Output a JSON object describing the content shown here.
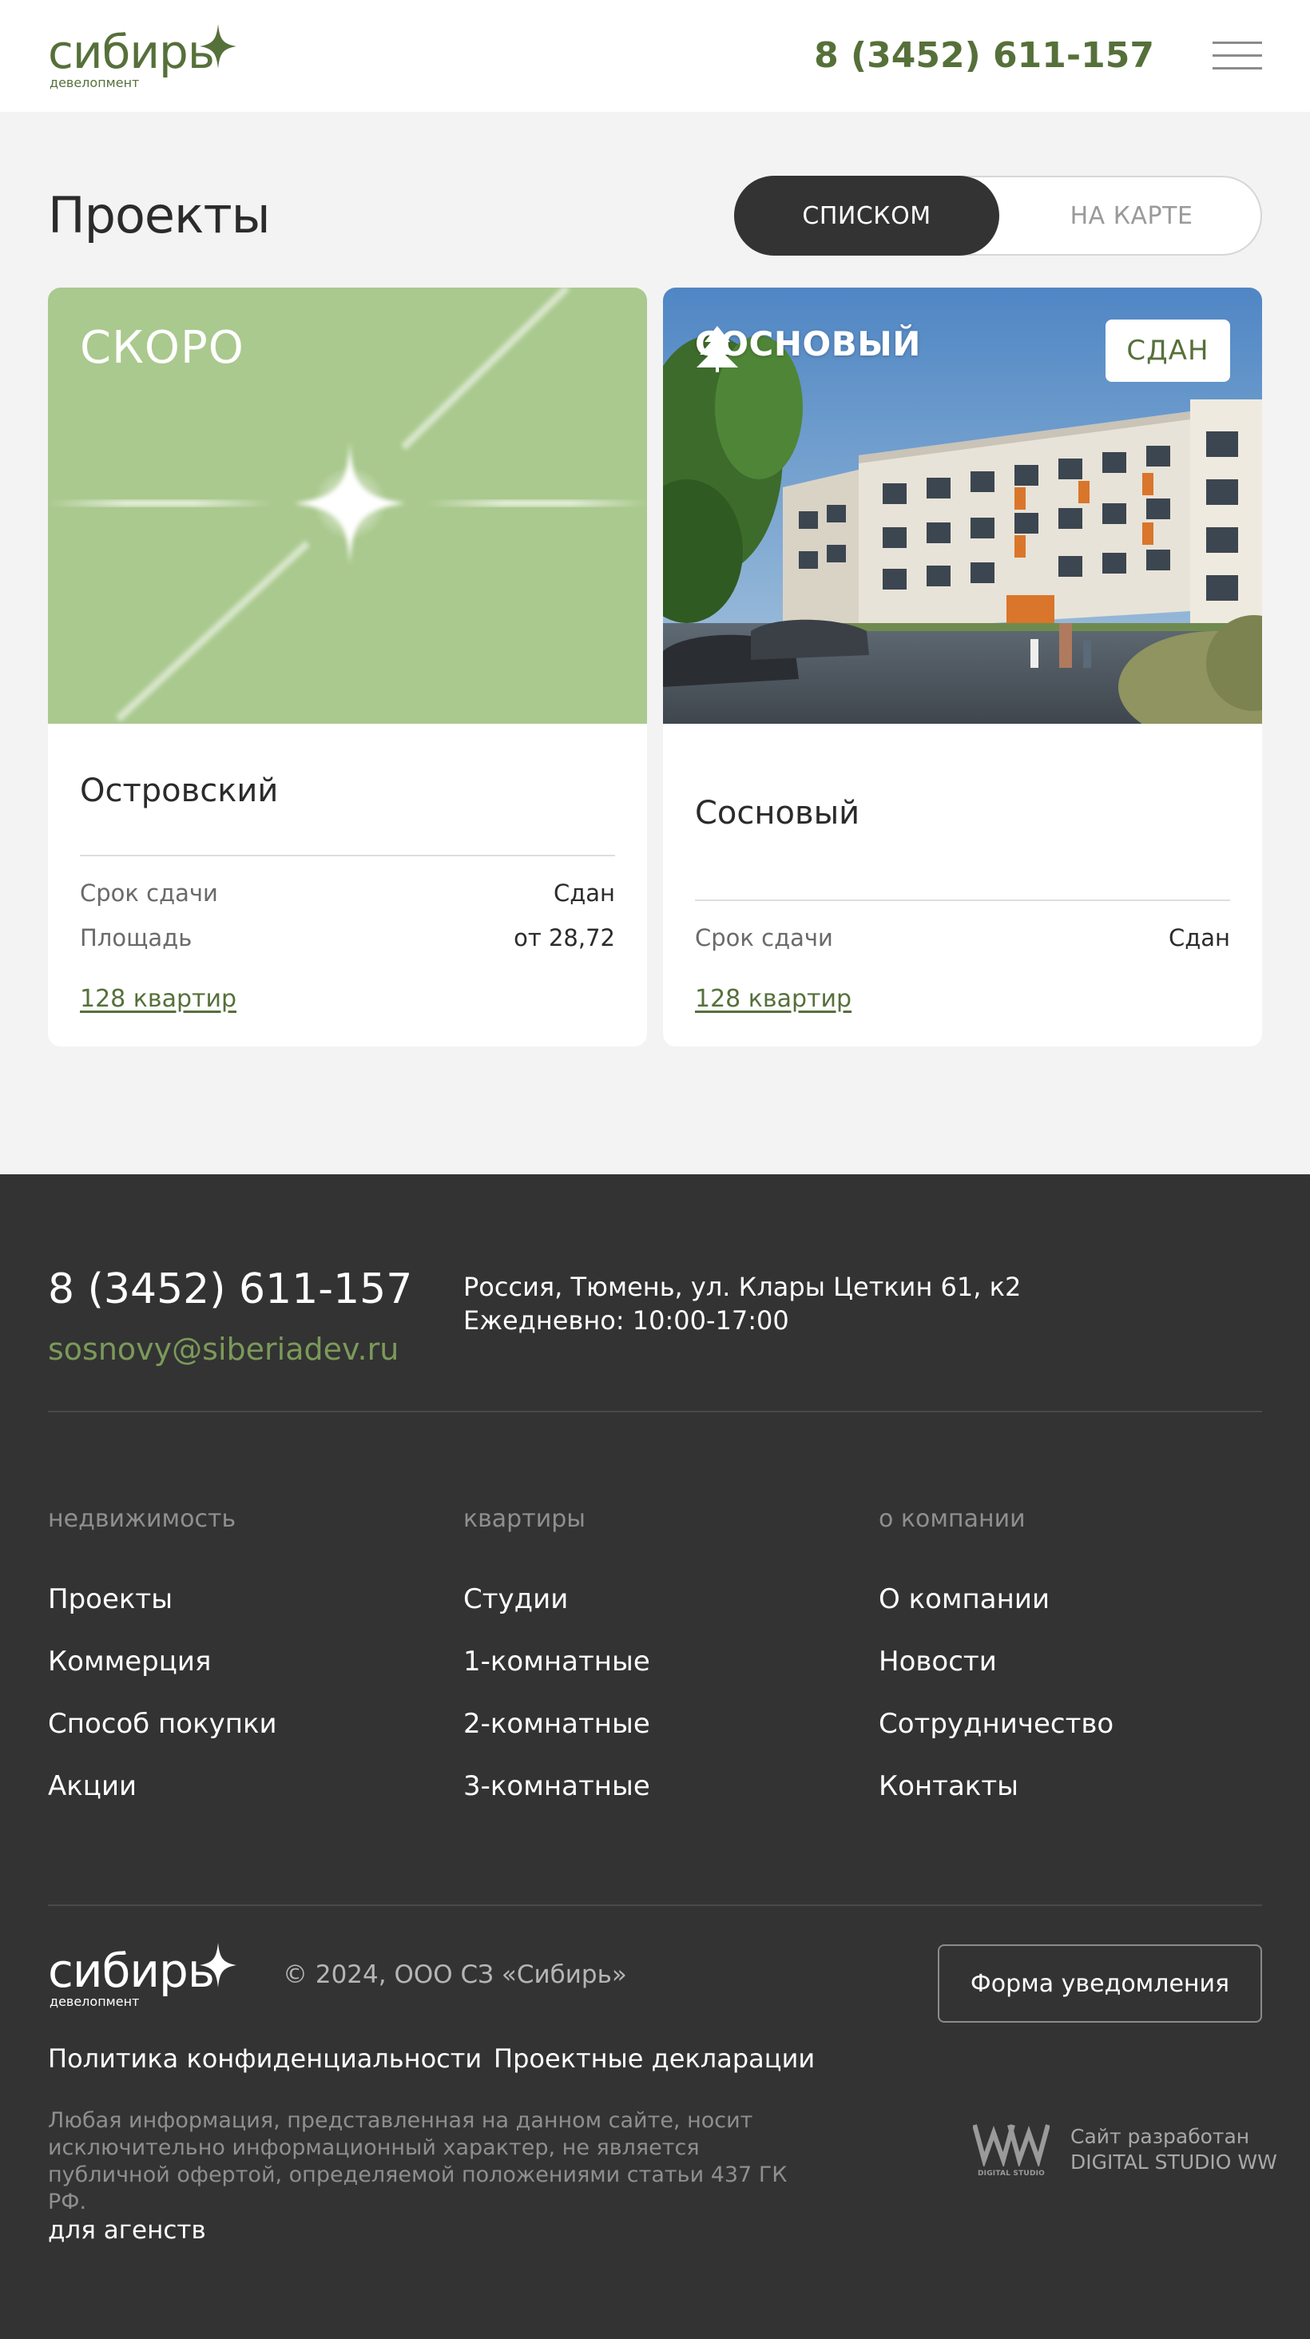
{
  "header": {
    "logo_word": "сибирь",
    "logo_sub": "девелопмент",
    "phone": "8 (3452) 611-157",
    "menu_icon": "burger-menu-icon"
  },
  "page": {
    "title": "Проекты",
    "view_toggle": {
      "list_label": "СПИСКОМ",
      "map_label": "НА КАРТЕ",
      "selected": "СПИСКОМ"
    }
  },
  "projects": [
    {
      "overlay_label": "СКОРО",
      "name": "Островский",
      "rows": [
        {
          "label": "Срок сдачи",
          "value": "Сдан"
        },
        {
          "label": "Площадь",
          "value": "от 28,72"
        }
      ],
      "apartments_link": "128 квартир"
    },
    {
      "brand_label": "СОСНОВЫЙ",
      "brand_icon": "pine-tree-icon",
      "status_badge": "СДАН",
      "name": "Сосновый",
      "rows": [
        {
          "label": "Срок сдачи",
          "value": "Сдан"
        }
      ],
      "apartments_link": "128 квартир"
    }
  ],
  "footer": {
    "phone": "8 (3452) 611-157",
    "email": "sosnovy@siberiadev.ru",
    "address_line1": "Россия, Тюмень, ул. Клары Цеткин 61, к2",
    "address_line2": "Ежедневно: 10:00-17:00",
    "columns": [
      {
        "title": "недвижимость",
        "links": [
          "Проекты",
          "Коммерция",
          "Способ покупки",
          "Акции"
        ]
      },
      {
        "title": "квартиры",
        "links": [
          "Студии",
          "1-комнатные",
          "2-комнатные",
          "3-комнатные"
        ]
      },
      {
        "title": "о компании",
        "links": [
          "О компании",
          "Новости",
          "Сотрудничество",
          "Контакты"
        ]
      }
    ],
    "logo_word": "сибирь",
    "logo_sub": "девелопмент",
    "copyright": "© 2024, ООО СЗ «Сибирь»",
    "notify_button": "Форма уведомления",
    "privacy_link": "Политика конфиденциальности",
    "declarations_link": "Проектные декларации",
    "disclaimer": "Любая информация, представленная на данном сайте, носит исключительно информационный характер, не является публичной офертой, определяемой положениями статьи 437 ГК РФ.",
    "agents_link": "для агенств",
    "studio_caption": "DIGITAL STUDIO",
    "studio_line1": "Сайт разработан",
    "studio_line2": "DIGITAL STUDIO WW"
  },
  "colors": {
    "brand_green": "#56703a",
    "soon_green": "#aac98e",
    "email_green": "#7b9a5a",
    "dark": "#333333",
    "page_bg": "#f3f3f3"
  }
}
